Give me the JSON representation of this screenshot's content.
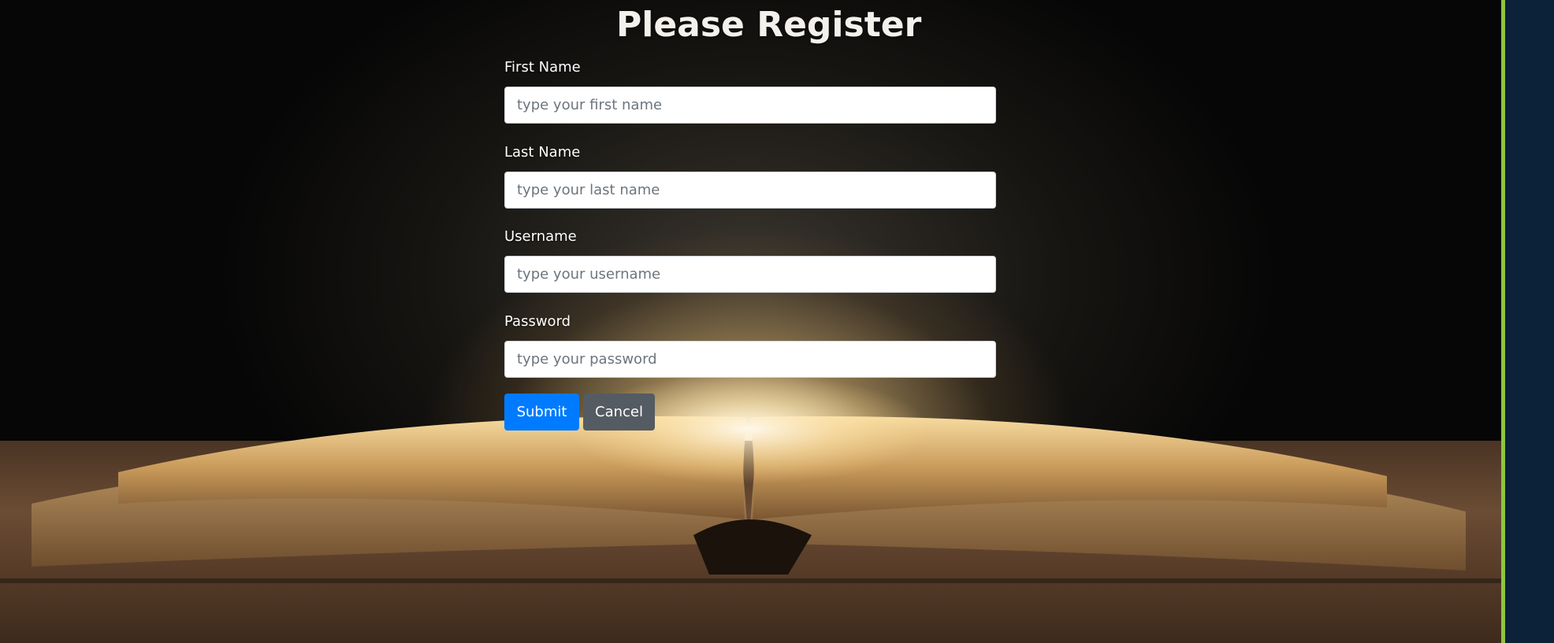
{
  "page": {
    "title": "Please Register"
  },
  "form": {
    "fields": [
      {
        "label": "First Name",
        "value": "",
        "placeholder": "type your first name"
      },
      {
        "label": "Last Name",
        "value": "",
        "placeholder": "type your last name"
      },
      {
        "label": "Username",
        "value": "",
        "placeholder": "type your username"
      },
      {
        "label": "Password",
        "value": "",
        "placeholder": "type your password"
      }
    ],
    "submit_label": "Submit",
    "cancel_label": "Cancel"
  },
  "colors": {
    "submit": "#007bff",
    "cancel": "#545b62",
    "rail_accent": "#8dc63f",
    "rail_bg": "#0b2238"
  }
}
